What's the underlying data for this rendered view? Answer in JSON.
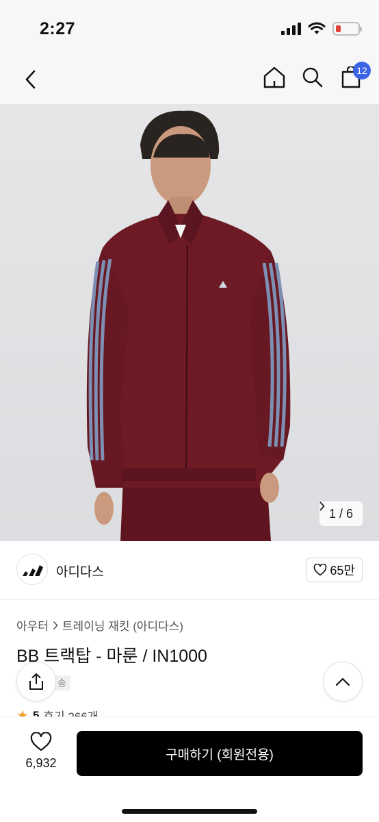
{
  "status_bar": {
    "time": "2:27"
  },
  "nav": {
    "back_icon": "chevron-left-icon",
    "home_icon": "home-icon",
    "search_icon": "search-icon",
    "cart_icon": "cart-icon",
    "cart_count": "12"
  },
  "gallery": {
    "pager": "1 / 6",
    "pager_icon": "chevron-right-icon"
  },
  "brand": {
    "name": "아디다스",
    "like_count": "65만"
  },
  "product": {
    "breadcrumb": [
      "아우터",
      "트레이닝 재킷 (아디다스)"
    ],
    "title": "BB 트랙탑 - 마룬 / IN1000",
    "shipping_tag": "송",
    "rating": "5",
    "reviews": "후기 266개"
  },
  "bottom": {
    "wish_count": "6,932",
    "buy_label": "구매하기 (회원전용)"
  },
  "colors": {
    "accent_badge": "#3a63e6",
    "buy_button": "#000000",
    "star": "#f0a12a",
    "jacket": "#6e1a24"
  }
}
